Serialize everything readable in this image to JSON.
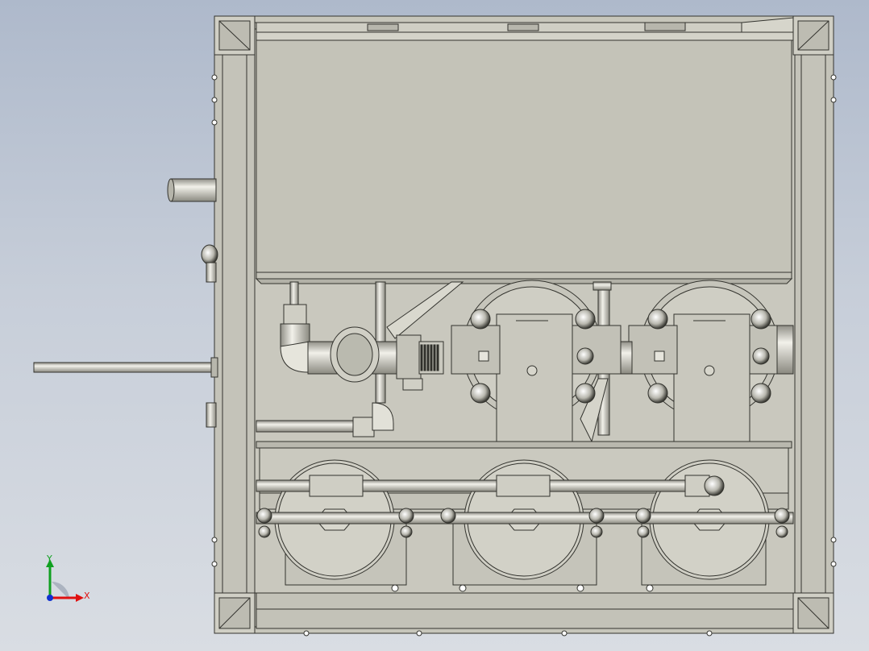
{
  "view": {
    "background_top": "#aeb9cb",
    "background_bottom": "#d9dde3",
    "model_fill": "#c7c6bb",
    "model_fill_light": "#d1d0c6",
    "model_outline": "#33332e"
  },
  "triad": {
    "x_label": "X",
    "y_label": "Y",
    "x_color": "#e01010",
    "y_color": "#10a020",
    "z_color": "#1030d0"
  }
}
